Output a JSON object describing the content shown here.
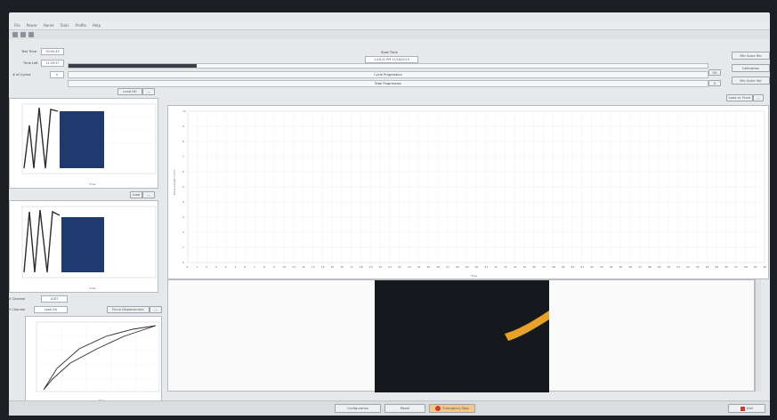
{
  "menu": [
    "File",
    "Power",
    "Home",
    "Tools",
    "Profile",
    "Help"
  ],
  "status": {
    "test_time_label": "Test Time",
    "test_time_value": "00:00:45",
    "time_left_label": "Time Left",
    "time_left_value": "12:29:57",
    "cycles_label": "# of Cycles",
    "cycles_value": "0"
  },
  "progress": {
    "start_time_label": "Start Time",
    "start_time_value": "1:46:31 PM 11/16/2015",
    "cycle_label": "Cycle Progression",
    "total_label": "Total Progression",
    "total_fraction": 0.2
  },
  "right_buttons": [
    "Min Scale Rib",
    "Calibration",
    "Min Scale Set"
  ],
  "right_small": [
    "OK",
    "0"
  ],
  "charts": {
    "load_select": "Load (N)",
    "pos_select": "Load",
    "main_select": "Load vs Force",
    "time_label": "Time",
    "scale_label": "Scale:",
    "bottom_xlabel": "Time",
    "main_ylabel": "Force Length (mm)",
    "main_xlabel": "Time",
    "fd_select": "Force Displacement"
  },
  "bottom_left": {
    "x_channel_label": "X Channel",
    "x_channel_value": "LVDT",
    "y_channel_label": "Y Channel",
    "y_channel_value": "Load (N)",
    "y_axis": "Load (N)",
    "x_axis": "Disp."
  },
  "bottom_bar": {
    "configure": "Configuration",
    "reset": "Reset",
    "emergency": "Emergency Stop",
    "exit": "Exit"
  },
  "chart_data": {
    "type": "line",
    "title": "",
    "xlabel": "",
    "ylabel": "Force Length (mm)",
    "ylim": [
      0,
      10
    ],
    "grid": true,
    "x": [
      0,
      1,
      2,
      3,
      4,
      5,
      6,
      7,
      8,
      9,
      10,
      11,
      12,
      13,
      14,
      15,
      16,
      17,
      18,
      19,
      20,
      21,
      22,
      23,
      24,
      25,
      26,
      27,
      28,
      29,
      30,
      31,
      32,
      33,
      34,
      35,
      36,
      37,
      38,
      39,
      40,
      41,
      42,
      43,
      44,
      45,
      46,
      47,
      48,
      49,
      50,
      51,
      52,
      53,
      54,
      55,
      56,
      57,
      58,
      59,
      60
    ],
    "series": []
  }
}
